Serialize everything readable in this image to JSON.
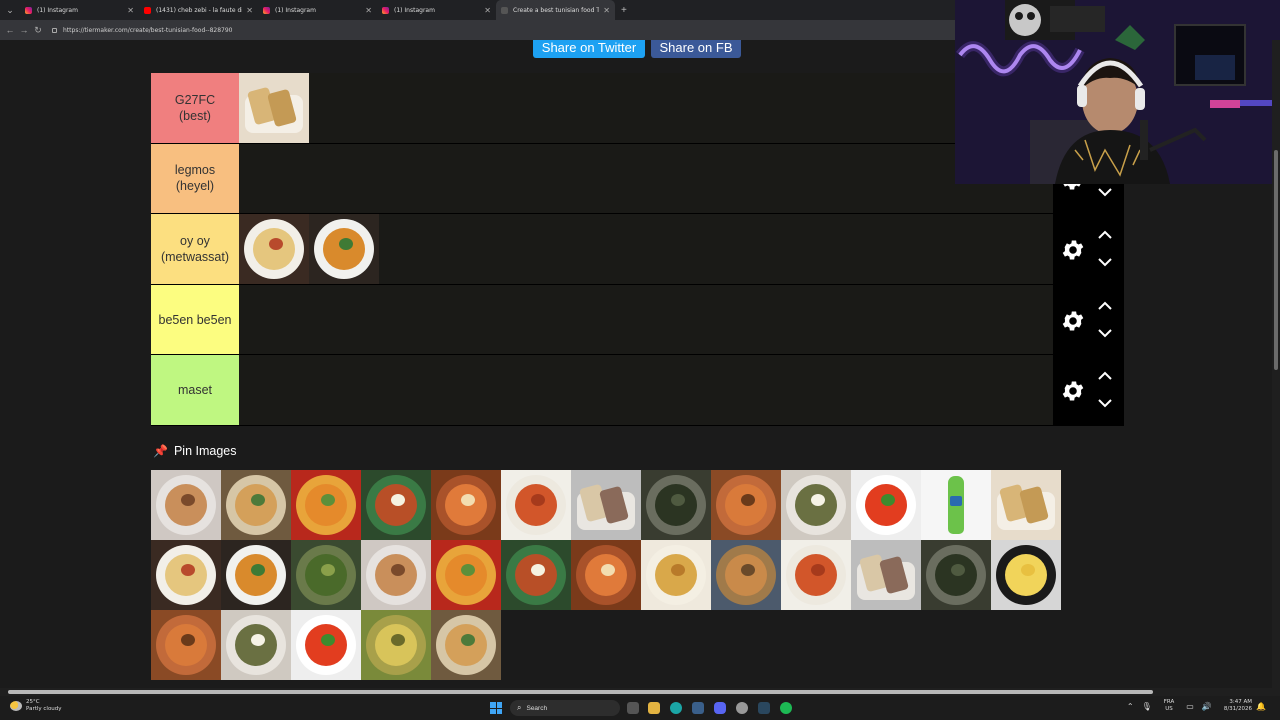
{
  "browser": {
    "tabs": [
      {
        "label": "(1) Instagram",
        "icon": "instagram-icon",
        "active": false
      },
      {
        "label": "(1431) cheb zebi - la faute diali x2",
        "icon": "youtube-icon",
        "active": false
      },
      {
        "label": "(1) Instagram",
        "icon": "instagram-icon",
        "active": false
      },
      {
        "label": "(1) Instagram",
        "icon": "instagram-icon",
        "active": false
      },
      {
        "label": "Create a best tunisian food Tier Li",
        "icon": "tiermaker-icon",
        "active": true
      }
    ],
    "url": "https://tiermaker.com/create/best-tunisian-food--828790"
  },
  "share": {
    "twitter": "Share on Twitter",
    "fb": "Share on FB"
  },
  "tiers": [
    {
      "label": "G27FC\n(best)",
      "color": "#f07f7f",
      "items": [
        "borek"
      ]
    },
    {
      "label": "legmos\n(heyel)",
      "color": "#f8bf80",
      "items": []
    },
    {
      "label": "oy oy\n(metwassat)",
      "color": "#fcdf80",
      "items": [
        "mlawi",
        "chorba"
      ]
    },
    {
      "label": "be5en be5en",
      "color": "#fcfd80",
      "items": []
    },
    {
      "label": "maset",
      "color": "#bff781",
      "items": []
    }
  ],
  "pool": {
    "title": "Pin Images",
    "items": [
      "chapati",
      "fricasse",
      "couscous",
      "lablabi-egg",
      "ojja",
      "kafteji-sauce",
      "mlawi-wrap",
      "mloukhia",
      "rechta",
      "lablabi-eggs",
      "spaghetti",
      "boga-bottle",
      "borek",
      "mlawi",
      "chorba",
      "spinach-fritters",
      "chapati",
      "couscous",
      "lablabi-egg",
      "ojja",
      "chorba-frik",
      "couscous-sauce",
      "kafteji-sauce",
      "mlawi-wrap",
      "mloukhia",
      "omelette-pan",
      "rechta",
      "lablabi-eggs",
      "spaghetti",
      "tajine",
      "fricasse"
    ]
  },
  "taskbar": {
    "weather_temp": "25°C",
    "weather_desc": "Partly cloudy",
    "search": "Search",
    "lang_top": "FRA",
    "lang_bottom": "US",
    "time": "3:47 AM",
    "date": "8/31/2026"
  },
  "colors": {
    "twitter": "#1da1f2",
    "facebook": "#3b5998",
    "tier_bg": "#1a1a17",
    "page_bg": "#1b1b1b"
  }
}
